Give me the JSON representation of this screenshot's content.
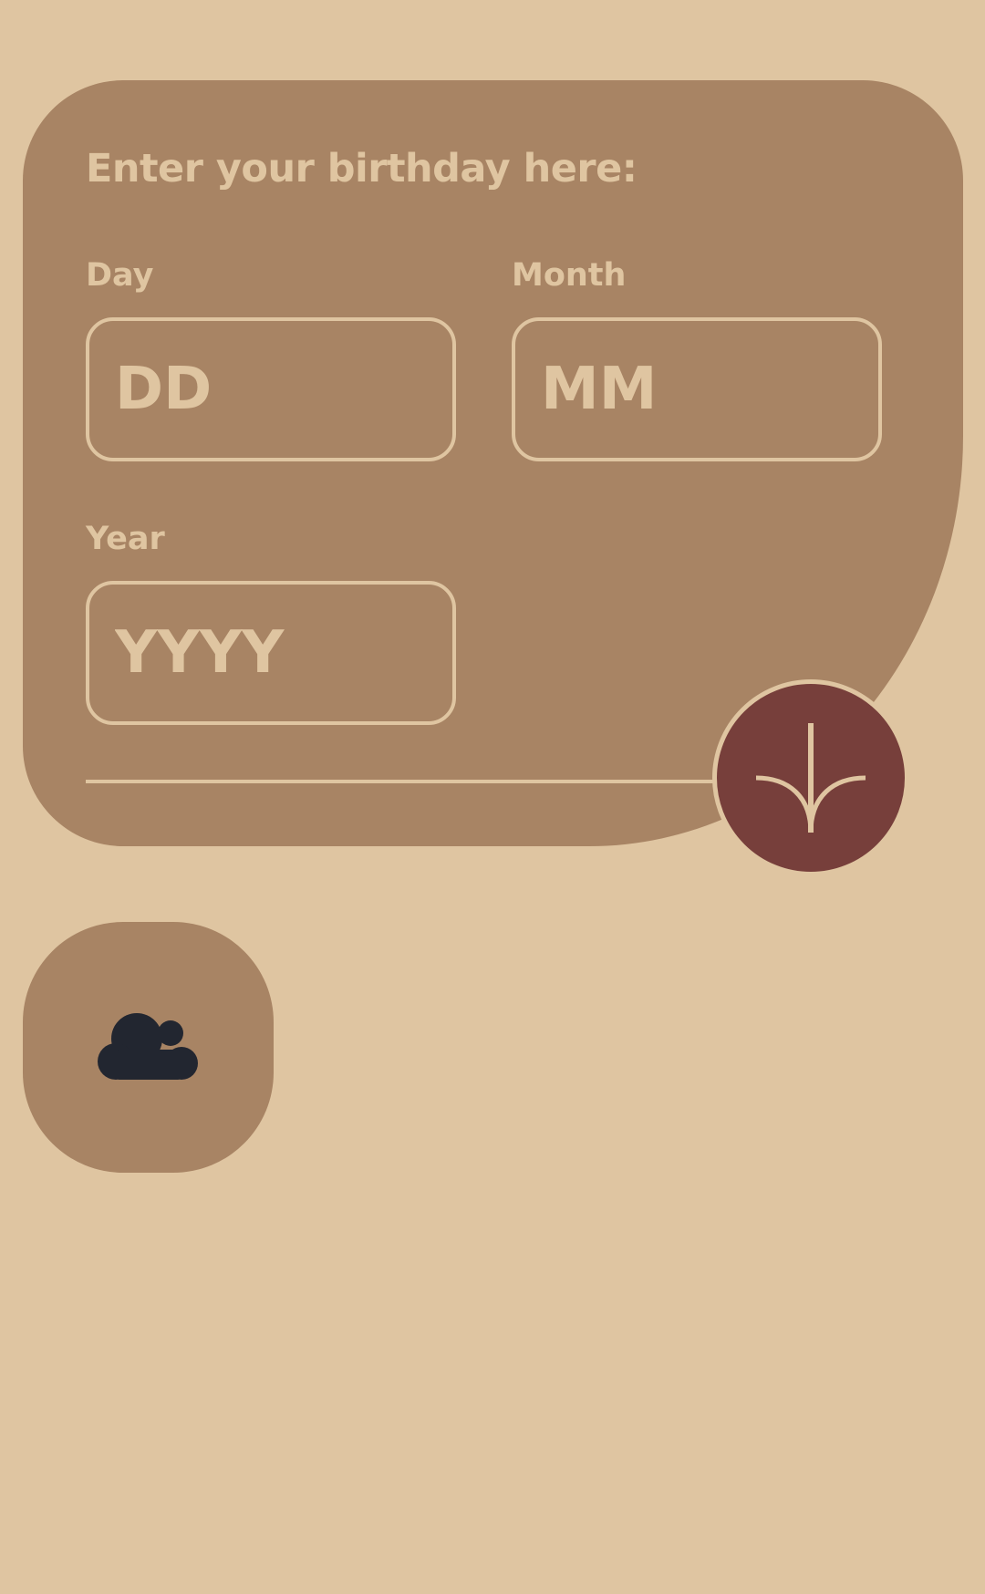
{
  "form": {
    "title": "Enter your birthday here:",
    "day": {
      "label": "Day",
      "placeholder": "DD",
      "value": ""
    },
    "month": {
      "label": "Month",
      "placeholder": "MM",
      "value": ""
    },
    "year": {
      "label": "Year",
      "placeholder": "YYYY",
      "value": ""
    }
  },
  "submit_button": {
    "icon": "sprout-arrow-down-icon"
  },
  "weather_tile": {
    "icon": "cloud-icon"
  },
  "colors": {
    "background": "#dfc5a1",
    "card": "#a88464",
    "accent": "#773f3b",
    "text": "#dfc5a1",
    "icon_dark": "#222630"
  }
}
